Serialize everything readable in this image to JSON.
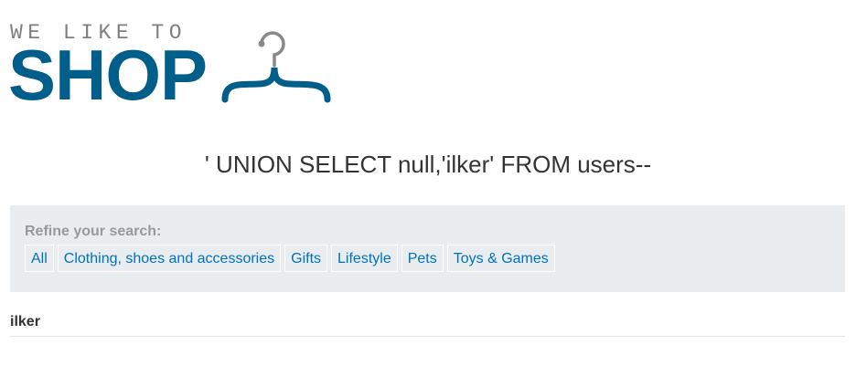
{
  "logo": {
    "tagline": "WE LIKE TO",
    "word": "SHOP",
    "brand_color": "#005e8a",
    "icon": "hanger-icon"
  },
  "heading": "' UNION SELECT null,'ilker' FROM users--",
  "filters": {
    "title": "Refine your search:",
    "categories": [
      {
        "label": "All"
      },
      {
        "label": "Clothing, shoes and accessories"
      },
      {
        "label": "Gifts"
      },
      {
        "label": "Lifestyle"
      },
      {
        "label": "Pets"
      },
      {
        "label": "Toys & Games"
      }
    ],
    "link_color": "#0071bc"
  },
  "results": [
    {
      "text": "ilker"
    }
  ]
}
